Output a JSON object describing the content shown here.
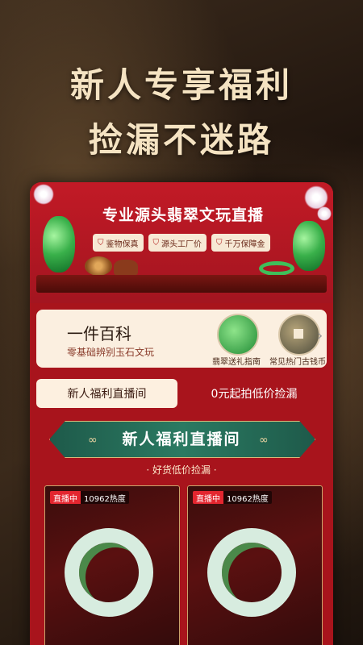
{
  "headline": {
    "line1": "新人专享福利",
    "line2": "捡漏不迷路"
  },
  "banner": {
    "title": "专业源头翡翠文玩直播",
    "chips": [
      {
        "icon": "shield-icon",
        "label": "鉴物保真"
      },
      {
        "icon": "factory-icon",
        "label": "源头工厂价"
      },
      {
        "icon": "gold-icon",
        "label": "千万保障金"
      }
    ]
  },
  "knowledge": {
    "title": "一件百科",
    "subtitle": "零基础辨别玉石文玩",
    "items": [
      {
        "label": "翡翠送礼指南"
      },
      {
        "label": "常见热门古钱币"
      }
    ],
    "arrow": "›"
  },
  "tabs": {
    "active": "新人福利直播间",
    "other": "0元起拍低价捡漏"
  },
  "section": {
    "title": "新人福利直播间",
    "subtitle": "· 好货低价捡漏 ·"
  },
  "live_cards": [
    {
      "status": "直播中",
      "heat": "10962热度"
    },
    {
      "status": "直播中",
      "heat": "10962热度"
    }
  ]
}
